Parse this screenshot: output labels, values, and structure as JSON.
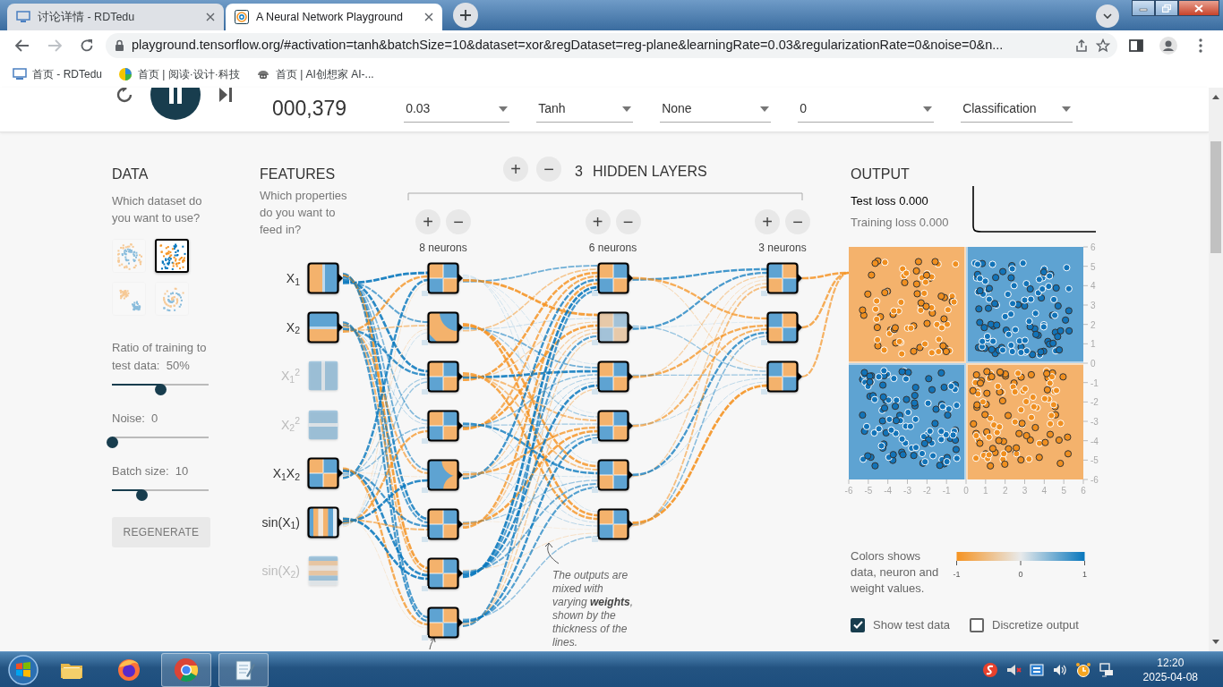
{
  "browser": {
    "tabs": [
      {
        "title": "讨论详情 - RDTedu",
        "selected": false
      },
      {
        "title": "A Neural Network Playground",
        "selected": true
      }
    ],
    "url": "playground.tensorflow.org/#activation=tanh&batchSize=10&dataset=xor&regDataset=reg-plane&learningRate=0.03&regularizationRate=0&noise=0&n...",
    "bookmarks": [
      {
        "title": "首页 - RDTedu",
        "kind": "monitor"
      },
      {
        "title": "首页 | 阅读·设计·科技",
        "kind": "pie"
      },
      {
        "title": "首页 | AI创想家 AI-...",
        "kind": "robot"
      }
    ]
  },
  "top_bar": {
    "epoch": "000,379",
    "dropdowns": [
      {
        "value": "0.03"
      },
      {
        "value": "Tanh"
      },
      {
        "value": "None"
      },
      {
        "value": "0"
      },
      {
        "value": "Classification"
      }
    ]
  },
  "data": {
    "title": "DATA",
    "prompt": "Which dataset do you want to use?",
    "datasets": [
      {
        "kind": "circle",
        "selected": false
      },
      {
        "kind": "xor",
        "selected": true
      },
      {
        "kind": "gauss",
        "selected": false
      },
      {
        "kind": "spiral",
        "selected": false
      }
    ],
    "sliders": [
      {
        "label": "Ratio of training to test data:  50%",
        "level": 0.5
      },
      {
        "label": "Noise:  0",
        "level": 0
      },
      {
        "label": "Batch size:  10",
        "level": 0.31
      }
    ],
    "regenerate": "REGENERATE"
  },
  "features": {
    "title": "FEATURES",
    "prompt": "Which properties do you want to feed in?",
    "items": [
      {
        "label": "X$_{1}$",
        "kind": "x1",
        "enabled": true
      },
      {
        "label": "X$_{2}$",
        "kind": "x2",
        "enabled": true
      },
      {
        "label": "X$_{1}$$^{2}$",
        "kind": "x1-squared",
        "enabled": false
      },
      {
        "label": "X$_{2}$$^{2}$",
        "kind": "x2-squared",
        "enabled": false
      },
      {
        "label": "X$_{1}$X$_{2}$",
        "kind": "xor",
        "enabled": true
      },
      {
        "label": "sin(X$_{1}$)",
        "kind": "sin-x1",
        "enabled": true
      },
      {
        "label": "sin(X$_{2}$)",
        "kind": "sin-x2",
        "enabled": false
      }
    ]
  },
  "hidden_layers": {
    "add": "+",
    "remove": "−",
    "count": "3",
    "title": "HIDDEN LAYERS",
    "layers": [
      {
        "add": "+",
        "remove": "−",
        "label": "8 neurons",
        "neurons": [
          {
            "kind": "xor"
          },
          {
            "kind": "corner"
          },
          {
            "kind": "xor"
          },
          {
            "kind": "xor"
          },
          {
            "kind": "corner-inverse"
          },
          {
            "kind": "xor"
          },
          {
            "kind": "xor"
          },
          {
            "kind": "inverse"
          }
        ]
      },
      {
        "add": "+",
        "remove": "−",
        "label": "6 neurons",
        "neurons": [
          {
            "kind": "xor"
          },
          {
            "kind": "faded"
          },
          {
            "kind": "xor"
          },
          {
            "kind": "xor"
          },
          {
            "kind": "inverse"
          },
          {
            "kind": "xor"
          }
        ]
      },
      {
        "add": "+",
        "remove": "−",
        "label": "3 neurons",
        "neurons": [
          {
            "kind": "inverse"
          },
          {
            "kind": "inverse"
          },
          {
            "kind": "inverse"
          }
        ]
      }
    ]
  },
  "annotation": "The outputs are mixed with varying **weights**, shown by the thickness of the lines.",
  "output": {
    "title": "OUTPUT",
    "test_loss": "Test loss 0.000",
    "training_loss": "Training loss 0.000",
    "y_ticks": [
      "6",
      "5",
      "4",
      "3",
      "2",
      "1",
      "0",
      "-1",
      "-2",
      "-3",
      "-4",
      "-5",
      "-6"
    ],
    "x_ticks": [
      "-6",
      "-5",
      "-4",
      "-3",
      "-2",
      "-1",
      "0",
      "1",
      "2",
      "3",
      "4",
      "5",
      "6"
    ],
    "legend": {
      "text": "Colors shows data, neuron and weight values.",
      "ticks": [
        "-1",
        "0",
        "1"
      ]
    },
    "checkboxes": [
      {
        "label": "Show test data",
        "checked": true
      },
      {
        "label": "Discretize output",
        "checked": false
      }
    ]
  },
  "taskbar": {
    "apps": [
      {
        "kind": "folder",
        "running": false
      },
      {
        "kind": "firefox",
        "running": false
      },
      {
        "kind": "chrome",
        "running": true
      },
      {
        "kind": "notepad",
        "running": true
      }
    ],
    "time": "12:20",
    "date": "2025-04-08"
  }
}
